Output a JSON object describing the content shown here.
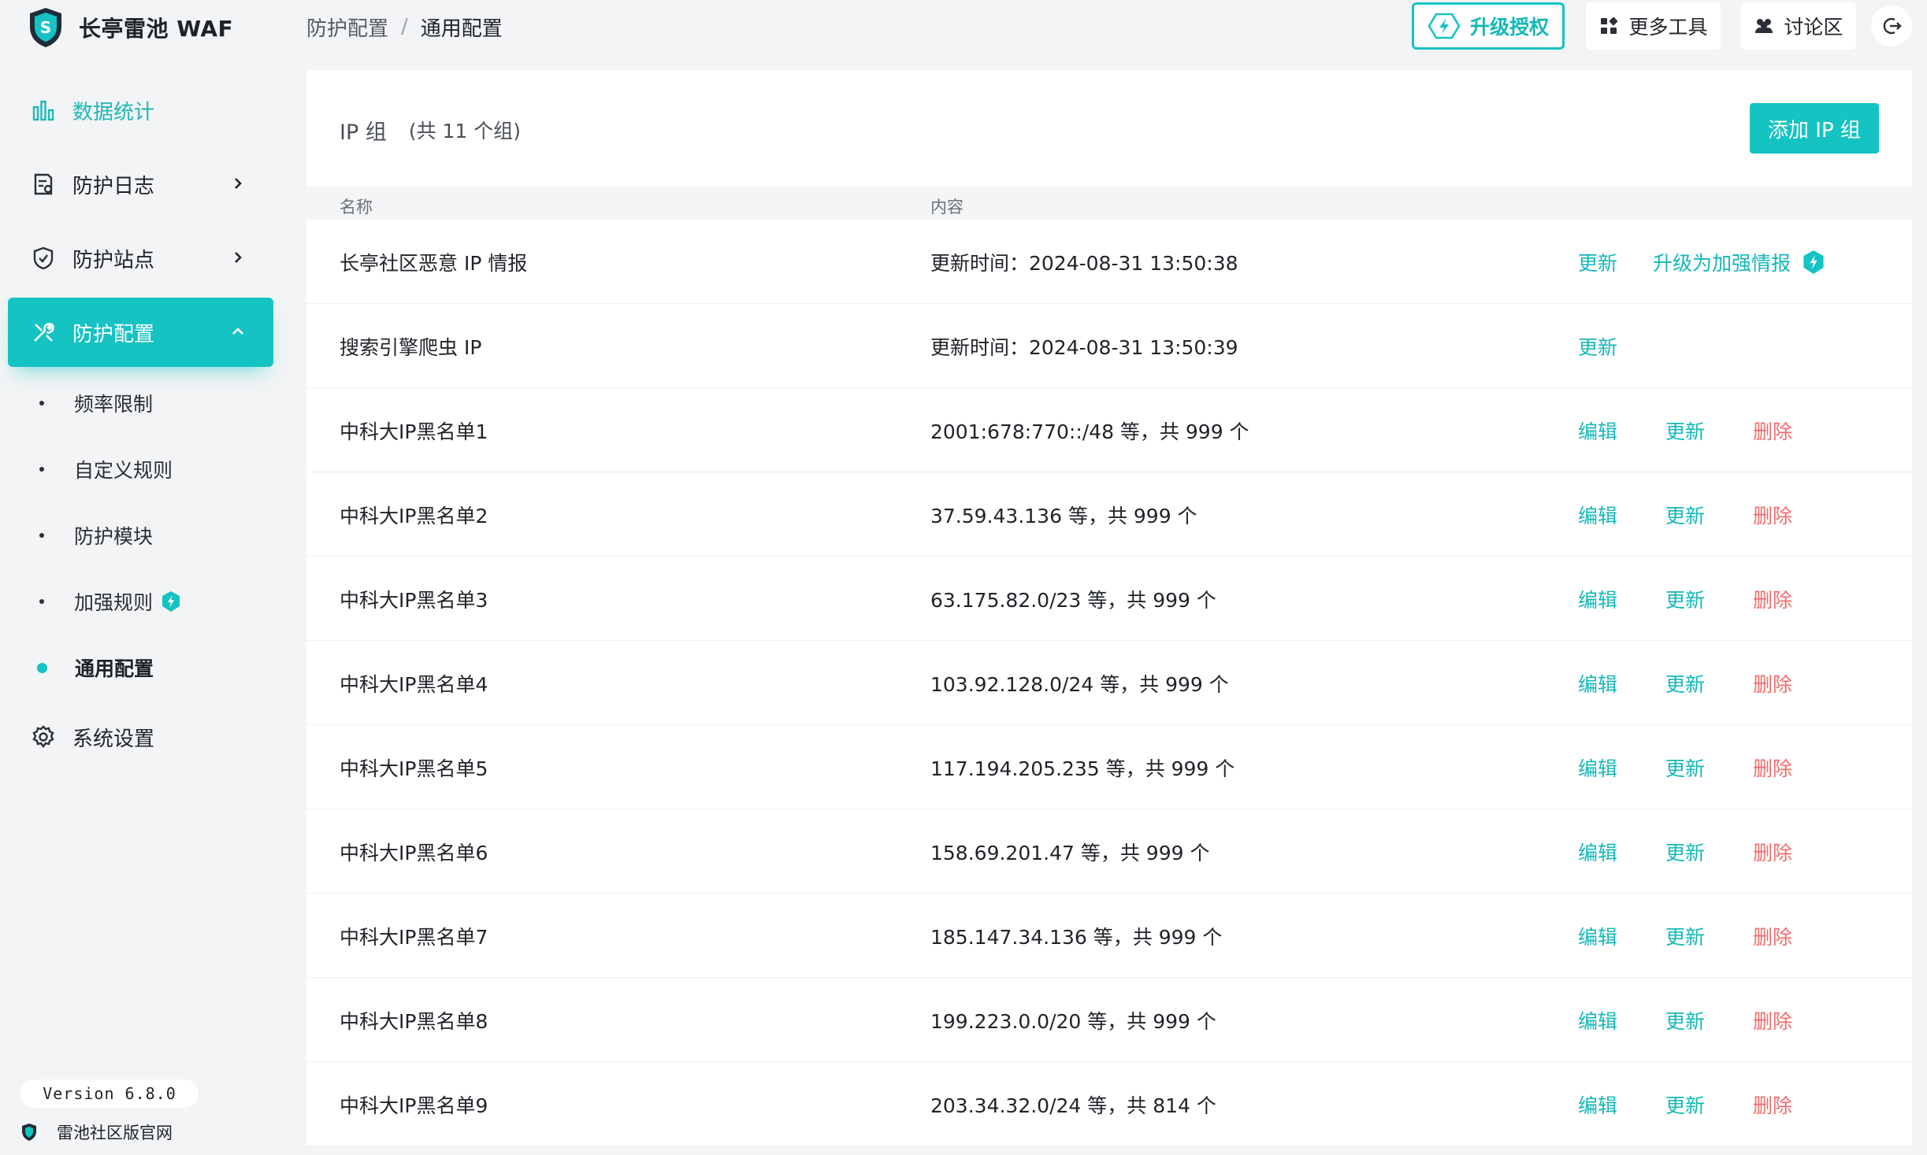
{
  "app": {
    "logo_text": "长亭雷池 WAF",
    "version": "Version 6.8.0",
    "official_site": "雷池社区版官网"
  },
  "colors": {
    "accent": "#15c3c3",
    "danger": "#f36b6b",
    "text": "#1f2329"
  },
  "sidebar": {
    "items": [
      {
        "label": "数据统计",
        "icon": "bar-chart-icon"
      },
      {
        "label": "防护日志",
        "icon": "log-icon"
      },
      {
        "label": "防护站点",
        "icon": "shield-icon"
      },
      {
        "label": "防护配置",
        "icon": "tools-icon"
      },
      {
        "label": "系统设置",
        "icon": "gear-icon"
      }
    ],
    "sub_items": [
      {
        "label": "频率限制"
      },
      {
        "label": "自定义规则"
      },
      {
        "label": "防护模块"
      },
      {
        "label": "加强规则"
      },
      {
        "label": "通用配置"
      }
    ]
  },
  "header": {
    "breadcrumb": [
      "防护配置",
      "通用配置"
    ],
    "breadcrumb_sep": "/",
    "upgrade_label": "升级授权",
    "tools_label": "更多工具",
    "forum_label": "讨论区"
  },
  "main": {
    "title": "IP 组",
    "count_text": "(共 11 个组)",
    "add_button": "添加 IP 组",
    "columns": [
      "名称",
      "内容"
    ],
    "actions": {
      "edit": "编辑",
      "update": "更新",
      "delete": "删除",
      "enhance": "升级为加强情报"
    },
    "rows": [
      {
        "name": "长亭社区恶意 IP 情报",
        "content": "更新时间：2024-08-31 13:50:38"
      },
      {
        "name": "搜索引擎爬虫 IP",
        "content": "更新时间：2024-08-31 13:50:39"
      },
      {
        "name": "中科大IP黑名单1",
        "content": "2001:678:770::/48 等，共 999 个"
      },
      {
        "name": "中科大IP黑名单2",
        "content": "37.59.43.136 等，共 999 个"
      },
      {
        "name": "中科大IP黑名单3",
        "content": "63.175.82.0/23 等，共 999 个"
      },
      {
        "name": "中科大IP黑名单4",
        "content": "103.92.128.0/24 等，共 999 个"
      },
      {
        "name": "中科大IP黑名单5",
        "content": "117.194.205.235 等，共 999 个"
      },
      {
        "name": "中科大IP黑名单6",
        "content": "158.69.201.47 等，共 999 个"
      },
      {
        "name": "中科大IP黑名单7",
        "content": "185.147.34.136 等，共 999 个"
      },
      {
        "name": "中科大IP黑名单8",
        "content": "199.223.0.0/20 等，共 999 个"
      },
      {
        "name": "中科大IP黑名单9",
        "content": "203.34.32.0/24 等，共 814 个"
      }
    ]
  }
}
